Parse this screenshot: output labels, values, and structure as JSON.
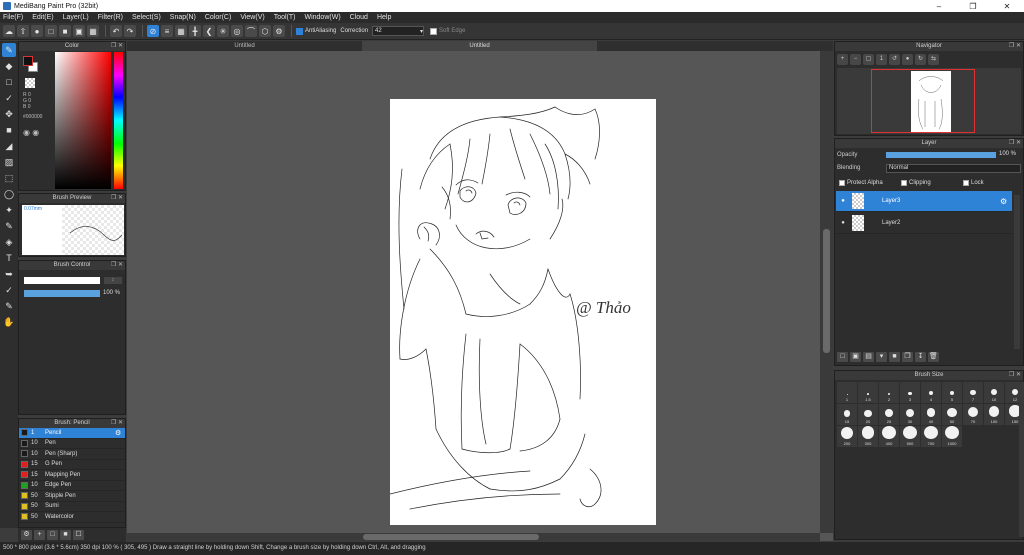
{
  "app": {
    "title": "MediBang Paint Pro (32bit)"
  },
  "menu": [
    "File(F)",
    "Edit(E)",
    "Layer(L)",
    "Filter(R)",
    "Select(S)",
    "Snap(N)",
    "Color(C)",
    "View(V)",
    "Tool(T)",
    "Window(W)",
    "Cloud",
    "Help"
  ],
  "toolbar": {
    "antialias_label": "AntiAliasing",
    "correction_label": "Correction",
    "correction_value": "42",
    "soft_edge_label": "Soft Edge"
  },
  "color_panel": {
    "title": "Color",
    "r": "R 0",
    "g": "G 0",
    "b": "B 0",
    "hex": "#000000"
  },
  "brush_preview": {
    "title": "Brush Preview",
    "size_label": "0.07mm"
  },
  "brush_control": {
    "title": "Brush Control",
    "opacity_label": "100 %",
    "opacity_fraction": 1.0
  },
  "brush_list": {
    "title": "Brush: Pencil",
    "items": [
      {
        "size": "1",
        "name": "Pencil",
        "color": "#1a1a1a",
        "selected": true
      },
      {
        "size": "10",
        "name": "Pen",
        "color": "#1a1a1a",
        "selected": false
      },
      {
        "size": "10",
        "name": "Pen (Sharp)",
        "color": "#1a1a1a",
        "selected": false
      },
      {
        "size": "15",
        "name": "G Pen",
        "color": "#e02020",
        "selected": false
      },
      {
        "size": "15",
        "name": "Mapping Pen",
        "color": "#e02020",
        "selected": false
      },
      {
        "size": "10",
        "name": "Edge Pen",
        "color": "#20a020",
        "selected": false
      },
      {
        "size": "50",
        "name": "Stipple Pen",
        "color": "#e0c020",
        "selected": false
      },
      {
        "size": "50",
        "name": "Sumi",
        "color": "#e0c020",
        "selected": false
      },
      {
        "size": "50",
        "name": "Watercolor",
        "color": "#e0c020",
        "selected": false
      }
    ]
  },
  "canvas": {
    "tab1": "Untitled",
    "tab2": "Untitled",
    "signature": "@ Thảo"
  },
  "navigator": {
    "title": "Navigator"
  },
  "layer_panel": {
    "title": "Layer",
    "opacity_label": "Opacity",
    "opacity_value": "100 %",
    "blending_label": "Blending",
    "blending_value": "Normal",
    "protect_alpha": "Protect Alpha",
    "clipping": "Clipping",
    "lock": "Lock",
    "layers": [
      {
        "name": "Layer3",
        "selected": true
      },
      {
        "name": "Layer2",
        "selected": false
      }
    ]
  },
  "brush_size": {
    "title": "Brush Size",
    "sizes": [
      "1",
      "1.5",
      "2",
      "3",
      "4",
      "5",
      "7",
      "10",
      "12",
      "15",
      "20",
      "25",
      "30",
      "40",
      "50",
      "70",
      "100",
      "150",
      "200",
      "300",
      "400",
      "500",
      "700",
      "1000"
    ]
  },
  "status": {
    "text": "500 * 800 pixel  (3.6 * 5.6cm)  350 dpi  100 %  ( 305, 495 )  Draw a straight line by holding down Shift, Change a brush size by holding down Ctrl, Alt, and dragging"
  }
}
